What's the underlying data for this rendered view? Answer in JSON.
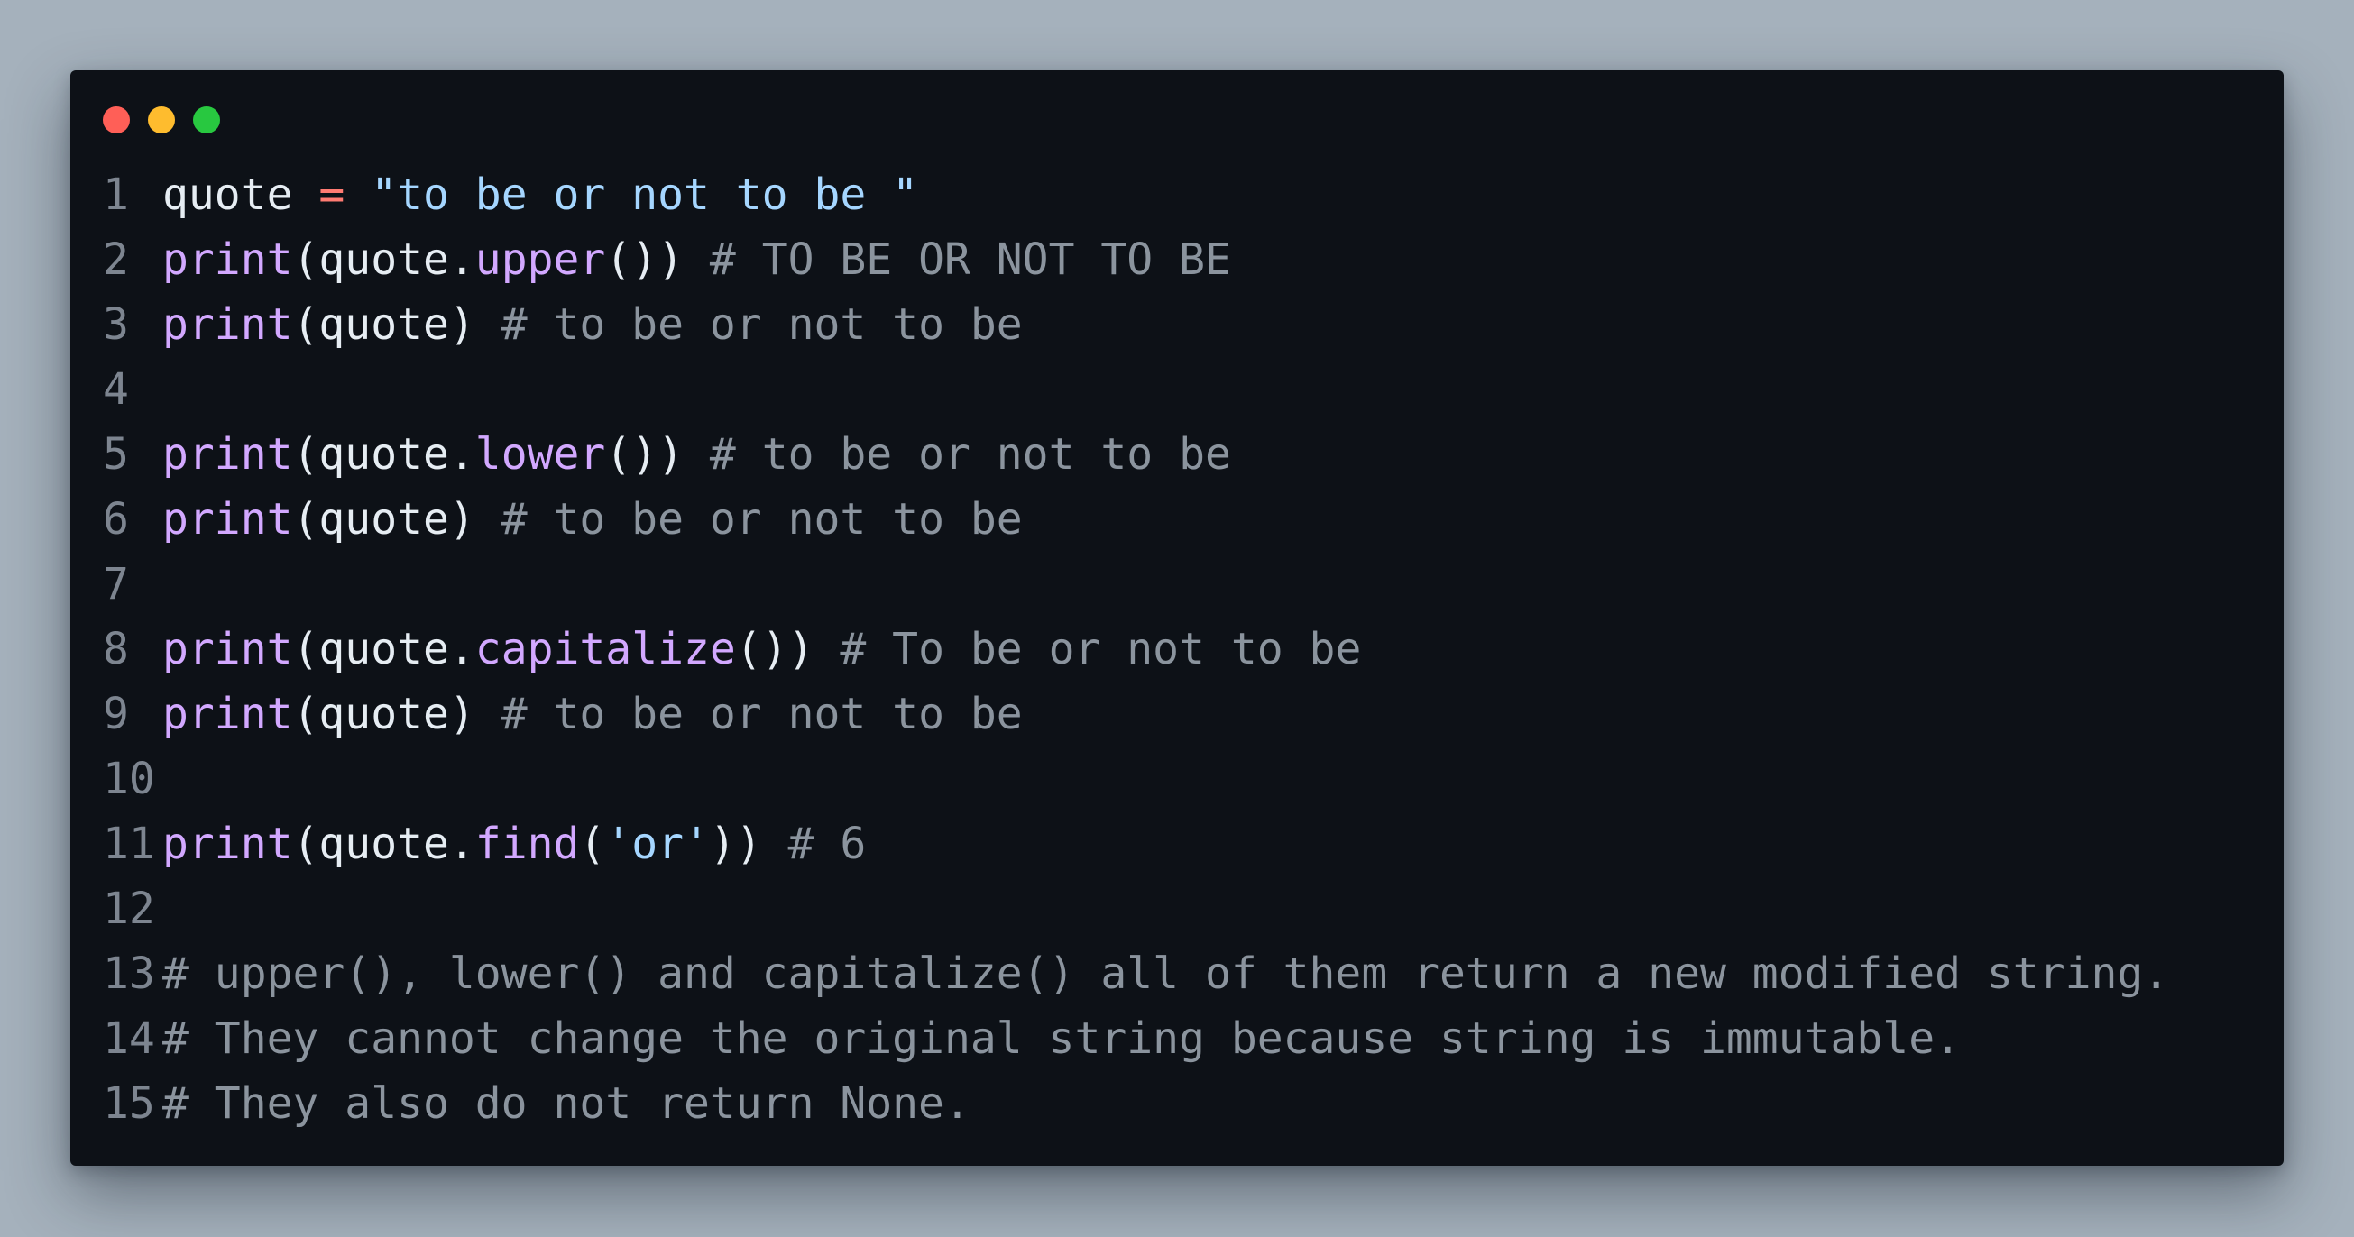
{
  "window": {
    "controls": [
      {
        "name": "close",
        "color": "#ff5f57"
      },
      {
        "name": "minimize",
        "color": "#febc2e"
      },
      {
        "name": "maximize",
        "color": "#28c840"
      }
    ]
  },
  "colors": {
    "background": "#a5b1bc",
    "editor_bg": "#0d1117",
    "line_number": "#7d8590",
    "identifier": "#e6edf3",
    "operator": "#ff7b72",
    "string": "#a5d6ff",
    "function": "#d2a8ff",
    "comment": "#8b949e"
  },
  "code": {
    "lines": [
      {
        "num": "1",
        "tokens": [
          {
            "t": "id",
            "v": "quote "
          },
          {
            "t": "op",
            "v": "="
          },
          {
            "t": "id",
            "v": " "
          },
          {
            "t": "str",
            "v": "\"to be or not to be \""
          }
        ]
      },
      {
        "num": "2",
        "tokens": [
          {
            "t": "fn",
            "v": "print"
          },
          {
            "t": "pn",
            "v": "(quote."
          },
          {
            "t": "fn",
            "v": "upper"
          },
          {
            "t": "pn",
            "v": "()) "
          },
          {
            "t": "cm",
            "v": "# TO BE OR NOT TO BE"
          }
        ]
      },
      {
        "num": "3",
        "tokens": [
          {
            "t": "fn",
            "v": "print"
          },
          {
            "t": "pn",
            "v": "(quote) "
          },
          {
            "t": "cm",
            "v": "# to be or not to be"
          }
        ]
      },
      {
        "num": "4",
        "tokens": []
      },
      {
        "num": "5",
        "tokens": [
          {
            "t": "fn",
            "v": "print"
          },
          {
            "t": "pn",
            "v": "(quote."
          },
          {
            "t": "fn",
            "v": "lower"
          },
          {
            "t": "pn",
            "v": "()) "
          },
          {
            "t": "cm",
            "v": "# to be or not to be"
          }
        ]
      },
      {
        "num": "6",
        "tokens": [
          {
            "t": "fn",
            "v": "print"
          },
          {
            "t": "pn",
            "v": "(quote) "
          },
          {
            "t": "cm",
            "v": "# to be or not to be"
          }
        ]
      },
      {
        "num": "7",
        "tokens": []
      },
      {
        "num": "8",
        "tokens": [
          {
            "t": "fn",
            "v": "print"
          },
          {
            "t": "pn",
            "v": "(quote."
          },
          {
            "t": "fn",
            "v": "capitalize"
          },
          {
            "t": "pn",
            "v": "()) "
          },
          {
            "t": "cm",
            "v": "# To be or not to be"
          }
        ]
      },
      {
        "num": "9",
        "tokens": [
          {
            "t": "fn",
            "v": "print"
          },
          {
            "t": "pn",
            "v": "(quote) "
          },
          {
            "t": "cm",
            "v": "# to be or not to be"
          }
        ]
      },
      {
        "num": "10",
        "tokens": []
      },
      {
        "num": "11",
        "tokens": [
          {
            "t": "fn",
            "v": "print"
          },
          {
            "t": "pn",
            "v": "(quote."
          },
          {
            "t": "fn",
            "v": "find"
          },
          {
            "t": "pn",
            "v": "("
          },
          {
            "t": "str",
            "v": "'or'"
          },
          {
            "t": "pn",
            "v": ")) "
          },
          {
            "t": "cm",
            "v": "# 6"
          }
        ]
      },
      {
        "num": "12",
        "tokens": []
      },
      {
        "num": "13",
        "tokens": [
          {
            "t": "cm",
            "v": "# upper(), lower() and capitalize() all of them return a new modified string."
          }
        ]
      },
      {
        "num": "14",
        "tokens": [
          {
            "t": "cm",
            "v": "# They cannot change the original string because string is immutable."
          }
        ]
      },
      {
        "num": "15",
        "tokens": [
          {
            "t": "cm",
            "v": "# They also do not return None."
          }
        ]
      }
    ]
  }
}
